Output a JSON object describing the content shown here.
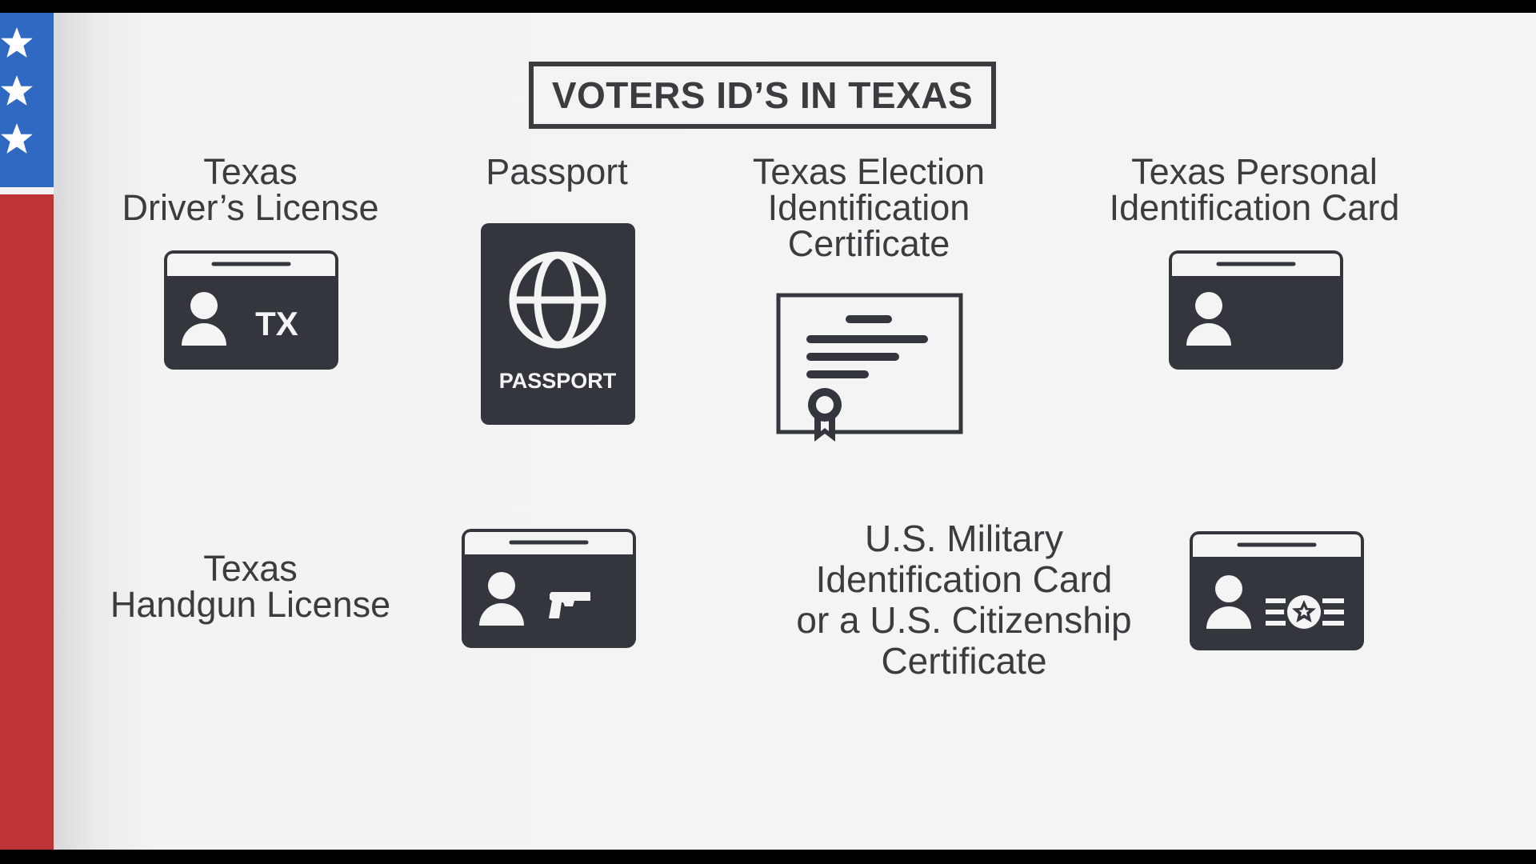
{
  "title": "VOTERS ID’S IN TEXAS",
  "colors": {
    "flag_blue": "#3069c2",
    "flag_red": "#bd3336",
    "icon_dark": "#33363c",
    "text": "#3b3c40",
    "background": "#f4f4f4"
  },
  "id_types": [
    {
      "label_lines": [
        "Texas",
        "Driver’s License"
      ],
      "icon": "drivers-license-card-icon",
      "card_text": "TX"
    },
    {
      "label_lines": [
        "Passport"
      ],
      "icon": "passport-icon",
      "card_text": "PASSPORT"
    },
    {
      "label_lines": [
        "Texas Election",
        "Identification",
        "Certificate"
      ],
      "icon": "certificate-icon"
    },
    {
      "label_lines": [
        "Texas Personal",
        "Identification Card"
      ],
      "icon": "personal-id-card-icon"
    },
    {
      "label_lines": [
        "Texas",
        "Handgun License"
      ],
      "icon": "handgun-license-card-icon"
    },
    {
      "label_lines": [
        "U.S. Military",
        "Identification Card",
        "or a U.S. Citizenship",
        "Certificate"
      ],
      "icon": "military-id-card-icon"
    }
  ]
}
